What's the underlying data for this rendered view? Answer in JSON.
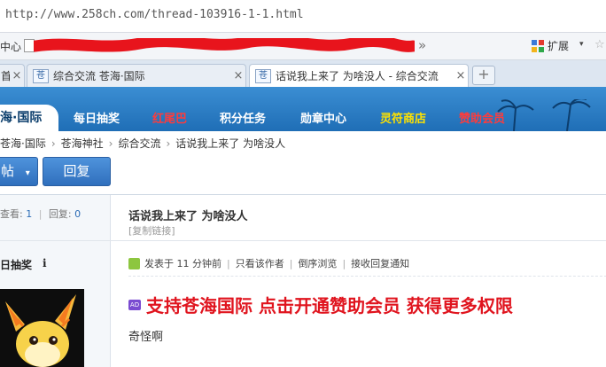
{
  "browser": {
    "url": "http://www.258ch.com/thread-103916-1-1.html",
    "bookmark_label": "中心",
    "more_glyph": "»",
    "extensions_label": "扩展",
    "caret": "▾",
    "tabs": [
      {
        "icon": "苍",
        "title": "综合交流 苍海·国际",
        "active": false
      },
      {
        "icon": "苍",
        "title": "话说我上来了 为啥没人 - 综合交流",
        "active": true
      }
    ],
    "partial_tab_title": "首",
    "new_tab": "+",
    "close": "×"
  },
  "site": {
    "logo": "海·国际",
    "nav": [
      {
        "label": "每日抽奖",
        "color": "#ffffff"
      },
      {
        "label": "红尾巴",
        "color": "#ff3b3b"
      },
      {
        "label": "积分任务",
        "color": "#ffffff"
      },
      {
        "label": "勋章中心",
        "color": "#ffffff"
      },
      {
        "label": "灵符商店",
        "color": "#ffe200"
      },
      {
        "label": "赞助会员",
        "color": "#ff3b3b"
      }
    ],
    "breadcrumb": [
      "苍海·国际",
      "苍海神社",
      "综合交流",
      "话说我上来了 为啥没人"
    ],
    "breadcrumb_sep": "›",
    "post_button": "帖",
    "post_caret": "▾",
    "reply_button": "回复"
  },
  "thread": {
    "views_label": "查看:",
    "views": "1",
    "replies_label": "回复:",
    "replies": "0",
    "title": "话说我上来了 为啥没人",
    "copy_link": "[复制链接]",
    "sidebar_title": "日抽奖",
    "info_glyph": "i",
    "meta": [
      "发表于 11 分钟前",
      "只看该作者",
      "倒序浏览",
      "接收回复通知"
    ],
    "meta_sep": "|",
    "ad_badge": "AD",
    "promo": "支持苍海国际 点击开通赞助会员 获得更多权限",
    "content": "奇怪啊"
  }
}
